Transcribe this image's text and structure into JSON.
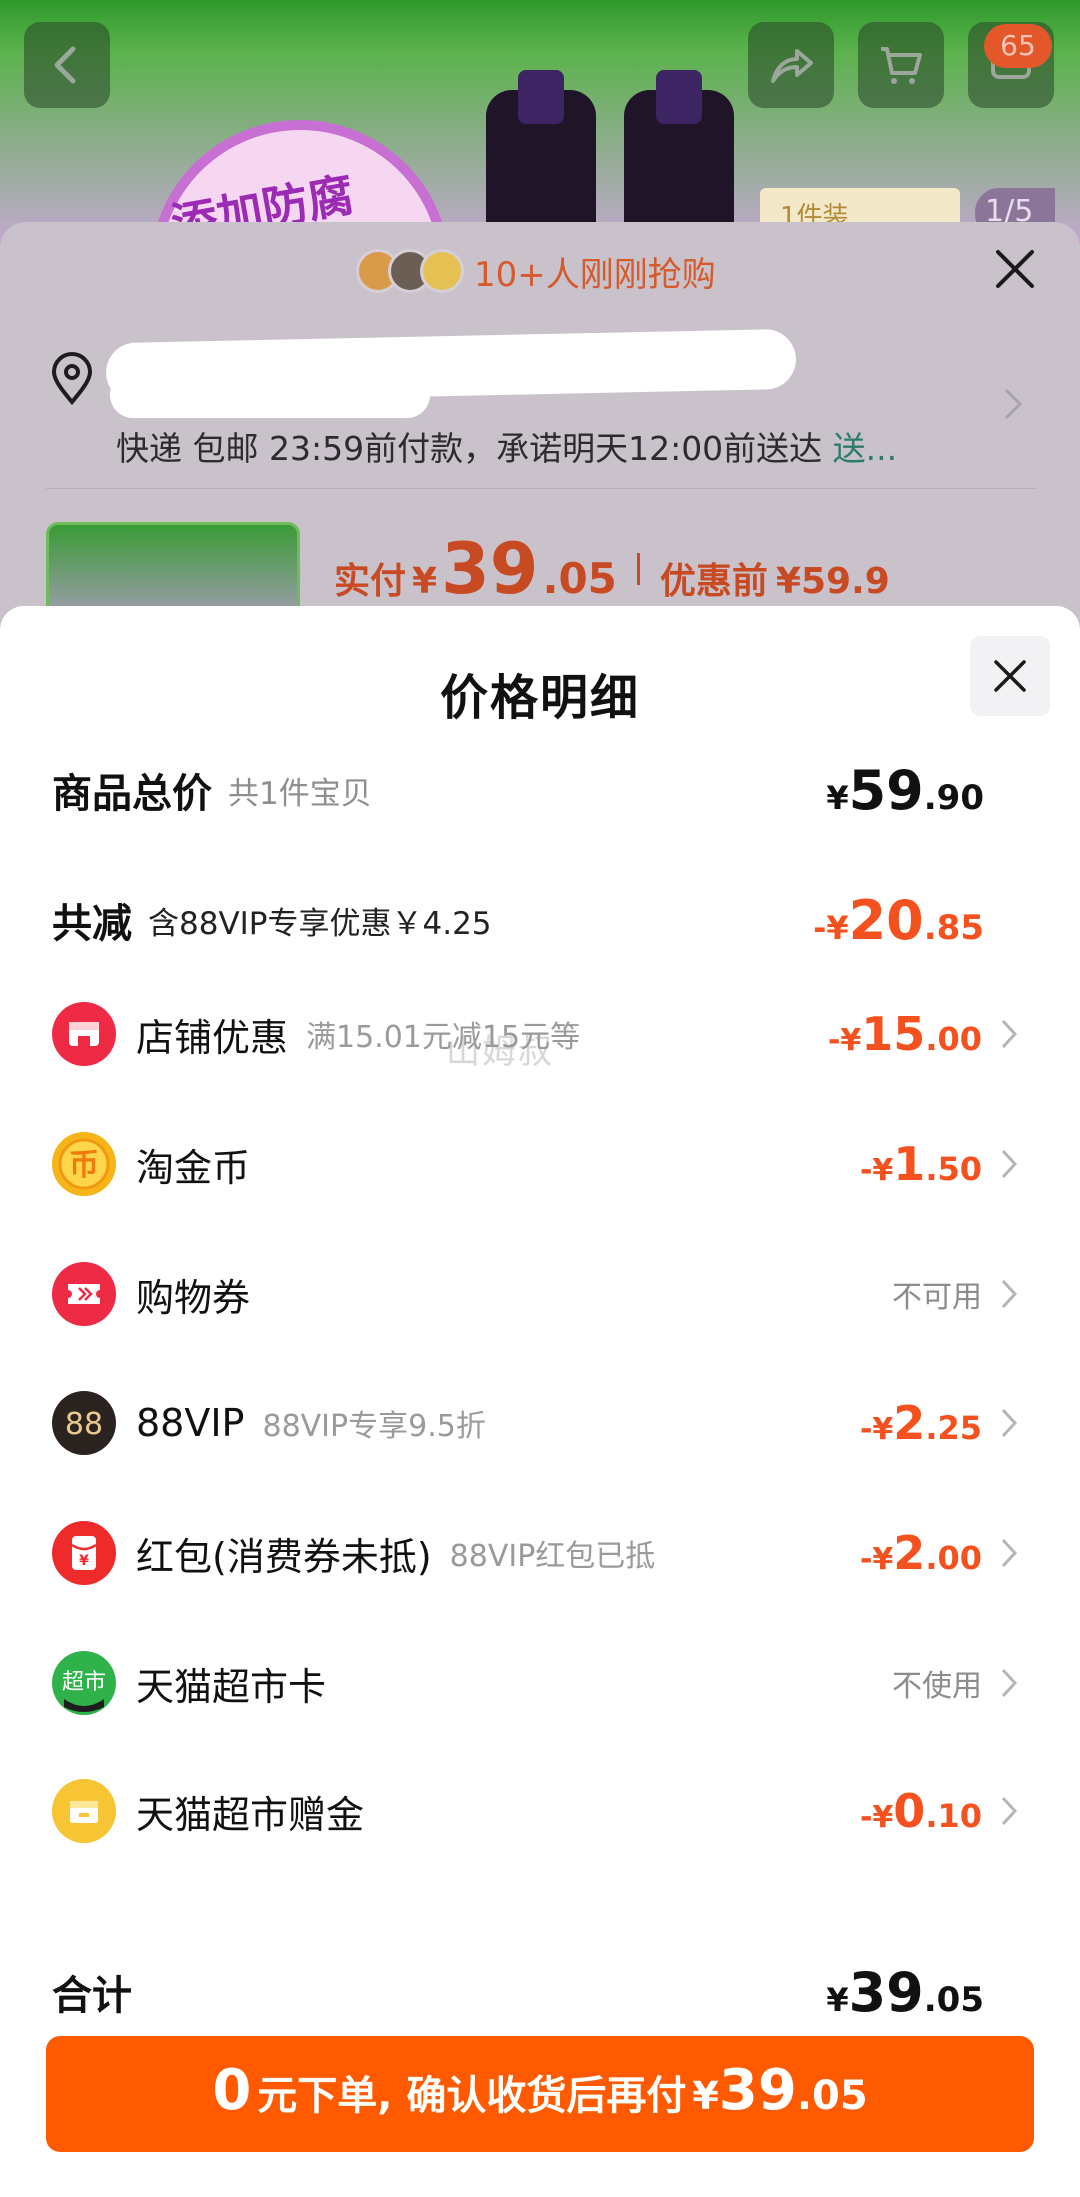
{
  "background": {
    "product_banner_text": "添加防腐",
    "sku_tag": "1件装",
    "image_counter": "1/5",
    "cart_badge": "65"
  },
  "sku_sheet": {
    "recent_buyers": "10+人刚刚抢购",
    "shipping_info": "快递 包邮 23:59前付款，承诺明天12:00前送达 ",
    "shipping_link": "送...",
    "price_label": "实付",
    "price_currency": "¥",
    "price_int": "39",
    "price_dec": ".05",
    "original_label": "优惠前",
    "original_price": "¥59.9"
  },
  "price_detail": {
    "title": "价格明细",
    "watermark": "山姆叔",
    "total_goods": {
      "label": "商品总价",
      "sub": "共1件宝贝",
      "currency": "¥",
      "int": "59",
      "dec": ".90"
    },
    "total_reduction": {
      "label": "共减",
      "sub": "含88VIP专享优惠￥4.25",
      "currency": "-¥",
      "int": "20",
      "dec": ".85"
    },
    "items": [
      {
        "name": "店铺优惠",
        "desc": "满15.01元减15元等",
        "currency": "-¥",
        "int": "15",
        "dec": ".00",
        "icon": "store-coupon-icon",
        "color": "#ef2a45"
      },
      {
        "name": "淘金币",
        "desc": "",
        "currency": "-¥",
        "int": "1",
        "dec": ".50",
        "icon": "gold-coin-icon",
        "color": "#f7b519"
      },
      {
        "name": "购物券",
        "desc": "",
        "status": "不可用",
        "icon": "shopping-voucher-icon",
        "color": "#ef2a45"
      },
      {
        "name": "88VIP",
        "desc": "88VIP专享9.5折",
        "currency": "-¥",
        "int": "2",
        "dec": ".25",
        "icon": "vip88-icon",
        "color": "#2b2320"
      },
      {
        "name": "红包(消费券未抵)",
        "desc": "88VIP红包已抵",
        "currency": "-¥",
        "int": "2",
        "dec": ".00",
        "icon": "red-packet-icon",
        "color": "#ef2a2a"
      },
      {
        "name": "天猫超市卡",
        "desc": "",
        "status": "不使用",
        "icon": "tmall-supermarket-card-icon",
        "color": "#2fb24a"
      },
      {
        "name": "天猫超市赠金",
        "desc": "",
        "currency": "-¥",
        "int": "0",
        "dec": ".10",
        "icon": "tmall-gift-money-icon",
        "color": "#f7c533"
      }
    ],
    "grand_total": {
      "label": "合计",
      "currency": "¥",
      "int": "39",
      "dec": ".05"
    },
    "cta": {
      "zero": "0",
      "text": "元下单, 确认收货后再付",
      "currency": "¥",
      "int": "39",
      "dec": ".05"
    }
  }
}
